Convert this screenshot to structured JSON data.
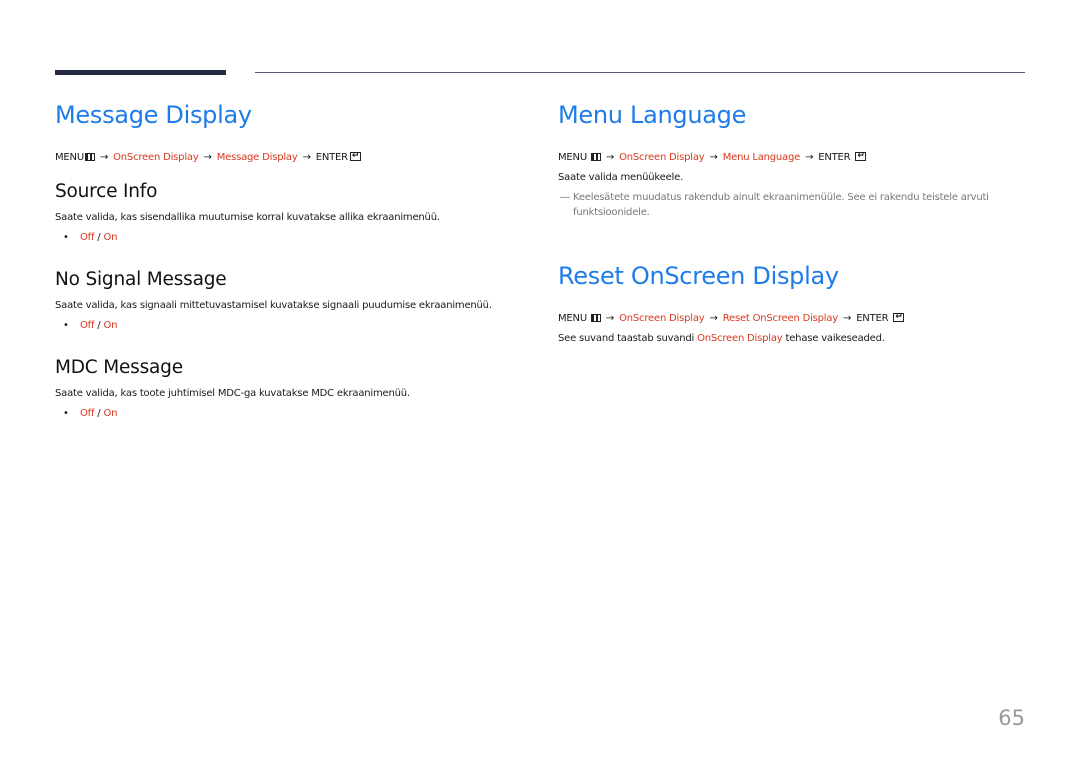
{
  "page_number": "65",
  "left": {
    "title": "Message Display",
    "path": {
      "menu": "MENU",
      "arrow": "→",
      "step1": "OnScreen Display",
      "step2": "Message Display",
      "enter": "ENTER"
    },
    "sections": [
      {
        "heading": "Source Info",
        "description": "Saate valida, kas sisendallika muutumise korral kuvatakse allika ekraanimenüü.",
        "option_off": "Off",
        "separator": "/",
        "option_on": "On"
      },
      {
        "heading": "No Signal Message",
        "description": "Saate valida, kas signaali mittetuvastamisel kuvatakse signaali puudumise ekraanimenüü.",
        "option_off": "Off",
        "separator": "/",
        "option_on": "On"
      },
      {
        "heading": "MDC Message",
        "description": "Saate valida, kas toote juhtimisel MDC-ga kuvatakse MDC ekraanimenüü.",
        "option_off": "Off",
        "separator": "/",
        "option_on": "On"
      }
    ]
  },
  "right": {
    "menu_language": {
      "title": "Menu Language",
      "path": {
        "menu": "MENU",
        "arrow": "→",
        "step1": "OnScreen Display",
        "step2": "Menu Language",
        "enter": "ENTER"
      },
      "description": "Saate valida menüükeele.",
      "note_dash": "―",
      "note": "Keelesätete muudatus rakendub ainult ekraanimenüüle. See ei rakendu teistele arvuti funktsioonidele."
    },
    "reset": {
      "title": "Reset OnScreen Display",
      "path": {
        "menu": "MENU",
        "arrow": "→",
        "step1": "OnScreen Display",
        "step2": "Reset OnScreen Display",
        "enter": "ENTER"
      },
      "description_pre": "See suvand taastab suvandi ",
      "description_link": "OnScreen Display",
      "description_post": " tehase vaikeseaded."
    }
  }
}
